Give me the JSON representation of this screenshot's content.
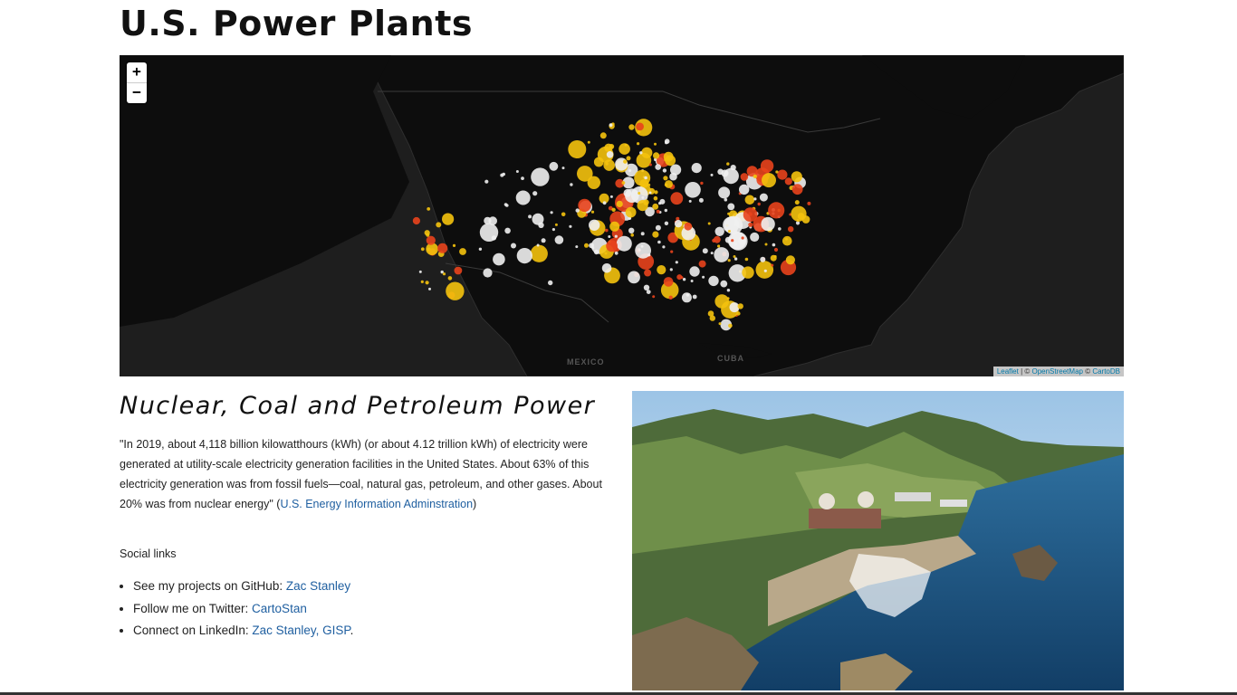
{
  "page": {
    "title": "U.S. Power Plants"
  },
  "map": {
    "zoom_in_label": "+",
    "zoom_out_label": "−",
    "labels": {
      "mexico": "MEXICO",
      "cuba": "CUBA"
    },
    "attribution": {
      "leaflet": "Leaflet",
      "separator": " | © ",
      "osm": "OpenStreetMap",
      "and": " © ",
      "carto": "CartoDB"
    },
    "colors": {
      "background": "#1e1e1e",
      "land": "#0d0d0d",
      "border": "#3a3a3a",
      "nuclear": "#e8431c",
      "coal": "#f0f0f0",
      "petroleum": "#f4c20d"
    },
    "legend_note": ""
  },
  "section": {
    "title": "Nuclear, Coal and Petroleum Power",
    "quote_text": "\"In 2019, about 4,118 billion kilowatthours (kWh) (or about 4.12 trillion kWh) of electricity were generated at utility-scale electricity generation facilities in the United States. About 63% of this electricity generation was from fossil fuels—coal, natural gas, petroleum, and other gases. About 20% was from nuclear energy\" (",
    "quote_link": "U.S. Energy Information Adminstration",
    "quote_close": ")"
  },
  "social": {
    "heading": "Social links",
    "items": [
      {
        "prefix": "See my projects on GitHub: ",
        "link": "Zac Stanley",
        "suffix": ""
      },
      {
        "prefix": "Follow me on Twitter: ",
        "link": "CartoStan",
        "suffix": ""
      },
      {
        "prefix": "Connect on LinkedIn: ",
        "link": "Zac Stanley, GISP",
        "suffix": "."
      }
    ]
  }
}
